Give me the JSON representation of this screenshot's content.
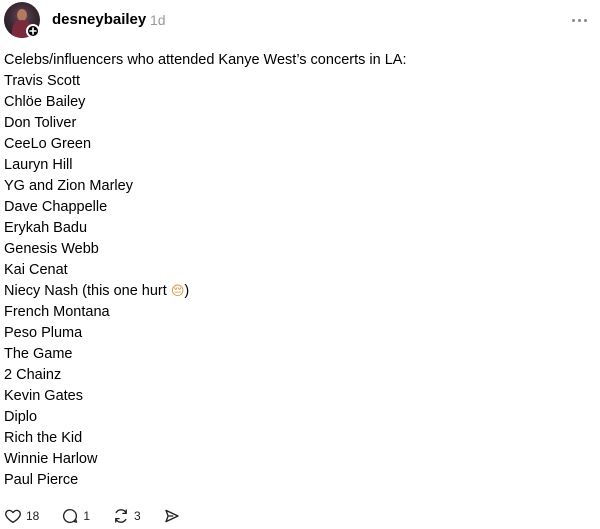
{
  "post": {
    "username": "desneybailey",
    "time": "1d",
    "intro": "Celebs/influencers who attended Kanye West’s concerts in LA:",
    "names": [
      "Travis Scott",
      "Chlöe Bailey",
      "Don Toliver",
      "CeeLo Green",
      "Lauryn Hill",
      "YG and Zion Marley",
      "Dave Chappelle",
      "Erykah Badu",
      "Genesis Webb",
      "Kai Cenat"
    ],
    "niecy": {
      "text": "Niecy Nash (this one hurt ",
      "emoji": "😔",
      "close": ")"
    },
    "names_after": [
      "French Montana",
      "Peso Pluma",
      "The Game",
      "2 Chainz",
      "Kevin Gates",
      "Diplo",
      "Rich the Kid",
      "Winnie Harlow",
      "Paul Pierce"
    ]
  },
  "actions": {
    "likes": "18",
    "replies": "1",
    "reposts": "3"
  },
  "icons": {
    "like": "heart-icon",
    "reply": "comment-icon",
    "repost": "repost-icon",
    "share": "send-icon",
    "more": "more-icon"
  }
}
